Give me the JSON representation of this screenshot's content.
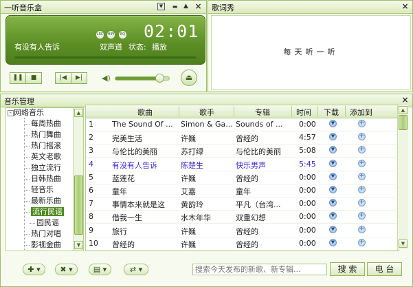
{
  "player": {
    "title": "一听音乐盒",
    "song": "有没有人告诉",
    "time": "02:01",
    "mode": "双声道",
    "status_label": "状态:",
    "status_value": "播放",
    "circle_buttons": [
      "LRC",
      "HIFI",
      "EQ"
    ]
  },
  "lyrics": {
    "title": "歌词秀",
    "text": "每天听一听"
  },
  "manager": {
    "title": "音乐管理",
    "tree_root": "网络音乐",
    "tree_items": [
      "每周热曲",
      "热门舞曲",
      "热门摇滚",
      "英文老歌",
      "独立流行",
      "日韩热曲",
      "轻音乐",
      "最新乐曲",
      "流行民谣",
      "园民谣",
      "热门对唱",
      "影视金曲"
    ],
    "selected_tree_index": 8,
    "columns": [
      "歌曲",
      "歌手",
      "专辑",
      "时间",
      "下载",
      "添加到"
    ],
    "rows": [
      {
        "no": "1",
        "song": "The Sound Of ...",
        "artist": "Simon & Ga...",
        "album": "Sounds of ...",
        "time": "0:00",
        "playing": false
      },
      {
        "no": "2",
        "song": "完美生活",
        "artist": "许巍",
        "album": "曾经的",
        "time": "4:57",
        "playing": false
      },
      {
        "no": "3",
        "song": "与伦比的美丽",
        "artist": "苏打绿",
        "album": "与伦比的美丽",
        "time": "5:08",
        "playing": false
      },
      {
        "no": "4",
        "song": "有没有人告诉",
        "artist": "陈楚生",
        "album": "快乐男声",
        "time": "5:45",
        "playing": true
      },
      {
        "no": "5",
        "song": "蓝莲花",
        "artist": "许巍",
        "album": "曾经的",
        "time": "0:00",
        "playing": false
      },
      {
        "no": "6",
        "song": "童年",
        "artist": "艾嘉",
        "album": "童年",
        "time": "0:00",
        "playing": false
      },
      {
        "no": "7",
        "song": "事情本来就是这",
        "artist": "黄韵玲",
        "album": "平凡（台湾...",
        "time": "0:00",
        "playing": false
      },
      {
        "no": "8",
        "song": "借我一生",
        "artist": "水木年华",
        "album": "双重幻想",
        "time": "0:00",
        "playing": false
      },
      {
        "no": "9",
        "song": "旅行",
        "artist": "许巍",
        "album": "曾经的",
        "time": "0:00",
        "playing": false
      },
      {
        "no": "10",
        "song": "曾经的",
        "artist": "许巍",
        "album": "曾经的",
        "time": "0:00",
        "playing": false
      }
    ],
    "search_placeholder": "搜索今天发布的新歌、新专辑...",
    "search_button": "搜 索",
    "radio_button": "电 台"
  },
  "colors": {
    "accent": "#5b8d24",
    "playing_row": "#3a2bd1",
    "selected_tree": "#4e8a1f"
  },
  "progress": {
    "volume": 0.82
  }
}
